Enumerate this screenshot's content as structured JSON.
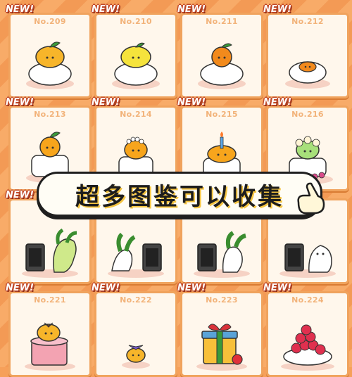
{
  "new_badge": "NEW!",
  "banner": {
    "text": "超多图鉴可以收集"
  },
  "cards": [
    {
      "number": "No.209",
      "item": "orange-mochi-icon",
      "new": true
    },
    {
      "number": "No.210",
      "item": "lemon-mochi-icon",
      "new": true
    },
    {
      "number": "No.211",
      "item": "mandarin-mochi-icon",
      "new": true
    },
    {
      "number": "No.212",
      "item": "small-orange-mochi-icon",
      "new": true
    },
    {
      "number": "No.213",
      "item": "cake-orange-icon",
      "new": true
    },
    {
      "number": "No.214",
      "item": "flower-crown-cake-icon",
      "new": true
    },
    {
      "number": "No.215",
      "item": "candle-cake-icon",
      "new": true
    },
    {
      "number": "No.216",
      "item": "flower-cake-icon",
      "new": true
    },
    {
      "number": "",
      "item": "heater-cabbage-icon",
      "new": true
    },
    {
      "number": "",
      "item": "cabbage-heater-icon",
      "new": false
    },
    {
      "number": "",
      "item": "heater-cabbage-2-icon",
      "new": false
    },
    {
      "number": "",
      "item": "heater-ghost-icon",
      "new": false
    },
    {
      "number": "No.221",
      "item": "hat-box-icon",
      "new": true
    },
    {
      "number": "No.222",
      "item": "bow-chick-icon",
      "new": true
    },
    {
      "number": "No.223",
      "item": "gift-box-icon",
      "new": true
    },
    {
      "number": "No.224",
      "item": "berry-pile-icon",
      "new": true
    }
  ]
}
